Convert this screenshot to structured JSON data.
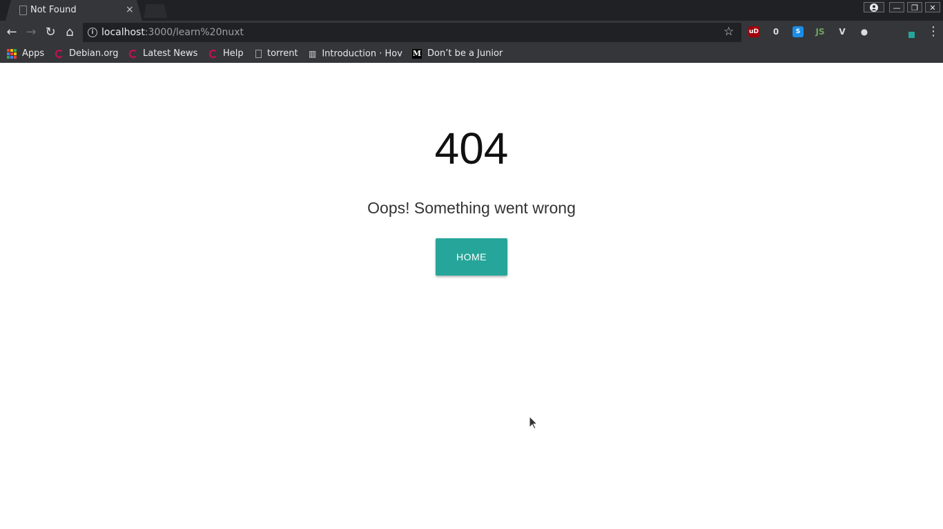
{
  "tab": {
    "title": "Not Found",
    "close_glyph": "×"
  },
  "window_controls": {
    "profile_icon": "account-circle-icon",
    "minimize": "—",
    "restore": "❐",
    "close": "✕"
  },
  "toolbar": {
    "back": "←",
    "forward": "→",
    "reload": "↻",
    "home": "⌂",
    "url_host": "localhost",
    "url_path": ":3000/learn%20nuxt",
    "star": "☆",
    "menu": "⋮"
  },
  "extensions": [
    {
      "name": "ublock-origin-icon",
      "label": "uD",
      "color": "#a3000b"
    },
    {
      "name": "cloud-extension-icon",
      "label": "0",
      "color": "#dadce0"
    },
    {
      "name": "s-extension-icon",
      "label": "S",
      "color": "#1a8de9"
    },
    {
      "name": "nodejs-extension-icon",
      "label": "JS",
      "color": "#6da55f"
    },
    {
      "name": "vue-devtools-icon",
      "label": "V",
      "color": "#dadce0"
    },
    {
      "name": "circle-extension-icon",
      "label": "●",
      "color": "#dadce0"
    },
    {
      "name": "dim-extension-icon",
      "label": "",
      "color": "#4a4b4f"
    },
    {
      "name": "pen-extension-icon",
      "label": "",
      "color": "#26a69a"
    }
  ],
  "bookmarks": [
    {
      "label": "Apps",
      "icon": "apps-grid-icon"
    },
    {
      "label": "Debian.org",
      "icon": "debian-icon"
    },
    {
      "label": "Latest News",
      "icon": "debian-icon"
    },
    {
      "label": "Help",
      "icon": "debian-icon"
    },
    {
      "label": "torrent",
      "icon": "document-icon"
    },
    {
      "label": "Introduction · Hov",
      "icon": "book-icon"
    },
    {
      "label": "Don’t be a Junior",
      "icon": "medium-icon"
    }
  ],
  "page": {
    "code": "404",
    "message": "Oops! Something went wrong",
    "home_label": "HOME",
    "accent": "#26a69a"
  }
}
